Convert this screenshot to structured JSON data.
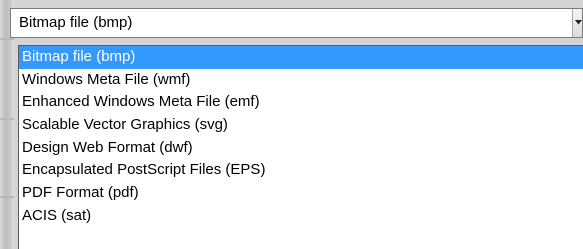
{
  "combo": {
    "value": "Bitmap file (bmp)",
    "arrow_icon": "chevron-down-icon"
  },
  "dropdown": {
    "selected_index": 0,
    "selection_color": "#3399ff",
    "options": [
      "Bitmap file (bmp)",
      "Windows Meta File (wmf)",
      "Enhanced Windows Meta File (emf)",
      "Scalable Vector Graphics (svg)",
      "Design Web Format (dwf)",
      "Encapsulated PostScript  Files (EPS)",
      "PDF Format (pdf)",
      "ACIS (sat)"
    ]
  }
}
